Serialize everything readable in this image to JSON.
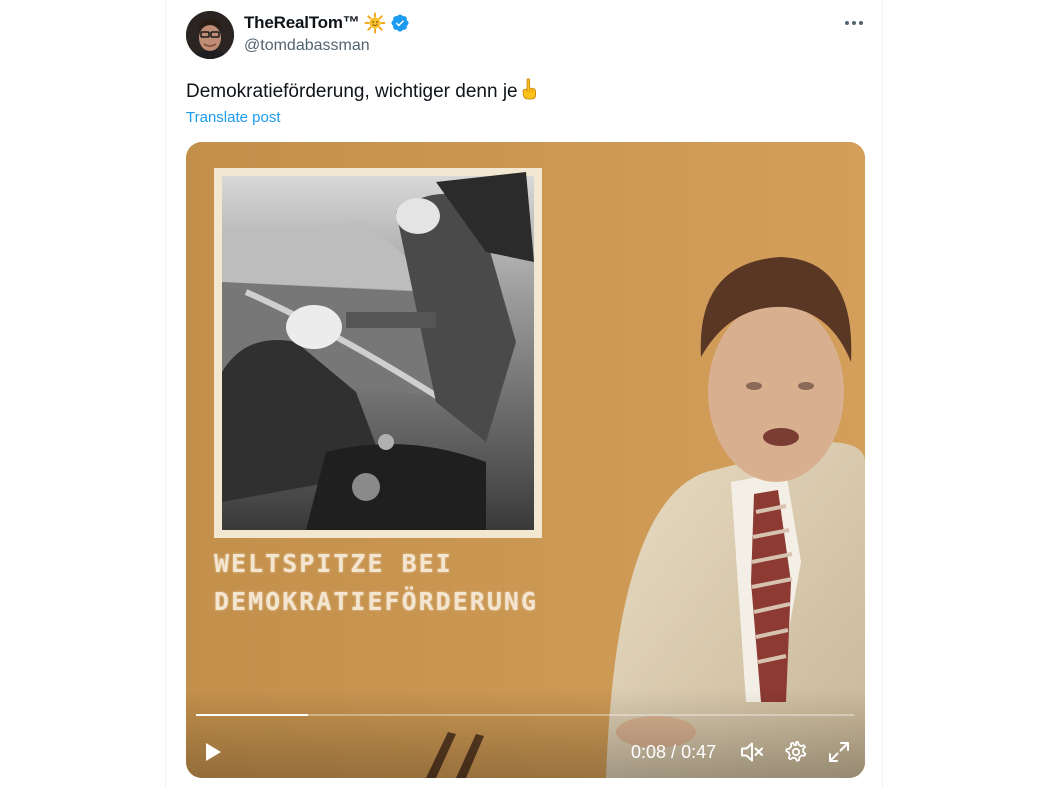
{
  "post": {
    "display_name": "TheRealTom™",
    "handle": "@tomdabassman",
    "text": "Demokratieförderung, wichtiger denn je",
    "translate_label": "Translate post"
  },
  "video": {
    "caption_line1": "WELTSPITZE BEI",
    "caption_line2": "DEMOKRATIEFÖRDERUNG",
    "current_time": "0:08",
    "duration": "0:47",
    "time_separator": " / ",
    "progress": 0.17
  },
  "colors": {
    "accent": "#1d9bf0",
    "text": "#0f1419",
    "secondary": "#536471",
    "video_background": "#c9954c"
  },
  "icons": {
    "sun": "sun-emoji-icon",
    "verified": "verified-badge-icon",
    "more": "more-horizontal-icon",
    "finger": "index-pointing-up-emoji-icon",
    "play": "play-icon",
    "mute": "volume-muted-icon",
    "settings": "gear-icon",
    "fullscreen": "fullscreen-icon"
  }
}
